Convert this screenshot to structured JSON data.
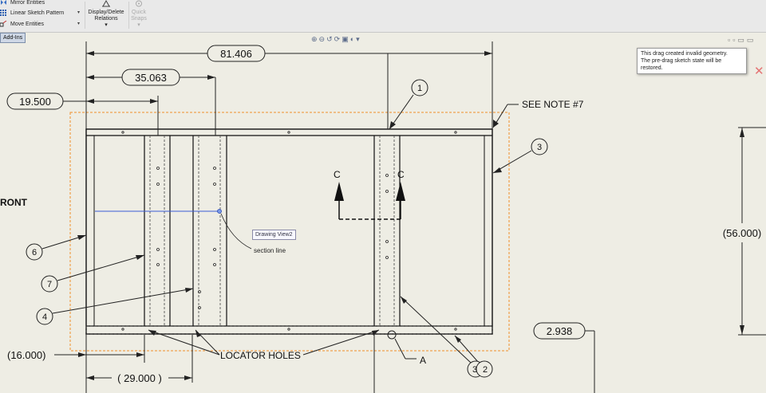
{
  "toolbar": {
    "items": [
      {
        "label": "Mirror Entities",
        "icon": "mirror-entities-icon"
      },
      {
        "label": "Linear Sketch Pattern",
        "icon": "linear-pattern-icon"
      },
      {
        "label": "Move Entities",
        "icon": "move-entities-icon"
      }
    ],
    "display_delete_relations": {
      "line1": "Display/Delete",
      "line2": "Relations"
    },
    "quick_snaps": {
      "line1": "Quick",
      "line2": "Snaps"
    },
    "addins_tab": "Add-Ins"
  },
  "heads_up_toolbar_icons": [
    "zoom-to-fit-icon",
    "zoom-to-area-icon",
    "previous-view-icon",
    "rebuild-icon",
    "display-style-icon",
    "hide-show-icon",
    "view-settings-icon"
  ],
  "tooltip": {
    "line1": "This drag created invalid geometry.",
    "line2": "The pre-drag sketch state will be",
    "line3": "restored."
  },
  "drawing": {
    "view_label": "RONT",
    "view_tag": "Drawing View2",
    "section_line_label": "section line",
    "section_letter_left": "C",
    "section_letter_right": "C",
    "note": "SEE NOTE #7",
    "locator_holes": "LOCATOR HOLES",
    "detail_label": "A",
    "dimensions": {
      "overall_width": "81.406",
      "width_2": "35.063",
      "width_3": "19.500",
      "height": "(56.000)",
      "offset_bottom": "(16.000)",
      "width_bottom": "( 29.000 )",
      "small_dim": "2.938"
    },
    "balloons": {
      "b1": "1",
      "b2": "2",
      "b3": "3",
      "b3b": "3",
      "b4": "4",
      "b6": "6",
      "b7": "7"
    }
  },
  "colors": {
    "background": "#eeede4",
    "view_boundary": "#f0902a",
    "selection_line": "#3b5bd6"
  }
}
